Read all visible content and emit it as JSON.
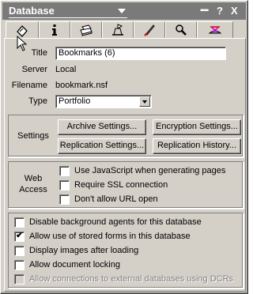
{
  "window": {
    "title": "Database",
    "help_label": "?",
    "close_label": "X"
  },
  "tabs": [
    {
      "icon": "info-circle-icon"
    },
    {
      "icon": "info-icon"
    },
    {
      "icon": "printer-icon"
    },
    {
      "icon": "design-icon"
    },
    {
      "icon": "rocket-icon"
    },
    {
      "icon": "search-icon"
    },
    {
      "icon": "hat-icon"
    }
  ],
  "fields": {
    "title_label": "Title",
    "title_value": "Bookmarks (6)",
    "server_label": "Server",
    "server_value": "Local",
    "filename_label": "Filename",
    "filename_value": "bookmark.nsf",
    "type_label": "Type",
    "type_value": "Portfolio"
  },
  "settings": {
    "label": "Settings",
    "archive_button": "Archive Settings...",
    "encryption_button": "Encryption Settings...",
    "replication_button": "Replication Settings...",
    "replication_history_button": "Replication History..."
  },
  "web_access": {
    "label_line1": "Web",
    "label_line2": "Access",
    "options": [
      {
        "label": "Use JavaScript when generating pages",
        "checked": false
      },
      {
        "label": "Require SSL connection",
        "checked": false
      },
      {
        "label": "Don't allow URL open",
        "checked": false
      }
    ]
  },
  "options": [
    {
      "label": "Disable background agents for this database",
      "checked": false,
      "disabled": false
    },
    {
      "label": "Allow use of stored forms in this database",
      "checked": true,
      "disabled": false
    },
    {
      "label": "Display images after loading",
      "checked": false,
      "disabled": false
    },
    {
      "label": "Allow document locking",
      "checked": false,
      "disabled": false
    },
    {
      "label": "Allow connections to external databases using DCRs",
      "checked": false,
      "disabled": true
    }
  ],
  "check_mark": "✔"
}
